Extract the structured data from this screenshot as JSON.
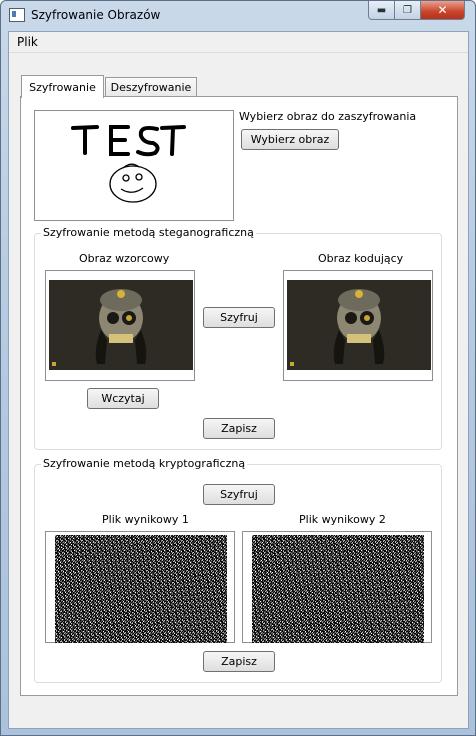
{
  "window": {
    "title": "Szyfrowanie Obrazów",
    "minimize_glyph": "▬",
    "maximize_glyph": "❐",
    "close_glyph": "✕"
  },
  "menu": {
    "items": [
      "Plik"
    ]
  },
  "tabs": [
    {
      "label": "Szyfrowanie",
      "active": true
    },
    {
      "label": "Deszyfrowanie",
      "active": false
    }
  ],
  "source": {
    "prompt": "Wybierz obraz do zaszyfrowania",
    "button": "Wybierz obraz",
    "preview_text": "TEST"
  },
  "stego": {
    "title": "Szyfrowanie metodą steganograficzną",
    "pattern_label": "Obraz wzorcowy",
    "coding_label": "Obraz kodujący",
    "encrypt_button": "Szyfruj",
    "load_button": "Wczytaj",
    "save_button": "Zapisz"
  },
  "crypto": {
    "title": "Szyfrowanie metodą kryptograficzną",
    "encrypt_button": "Szyfruj",
    "result1_label": "Plik wynikowy 1",
    "result2_label": "Plik wynikowy 2",
    "save_button": "Zapisz"
  },
  "colors": {
    "title_bar": "#b7cbe1",
    "close_button": "#c9432a",
    "panel_bg": "#f0f0f0"
  }
}
